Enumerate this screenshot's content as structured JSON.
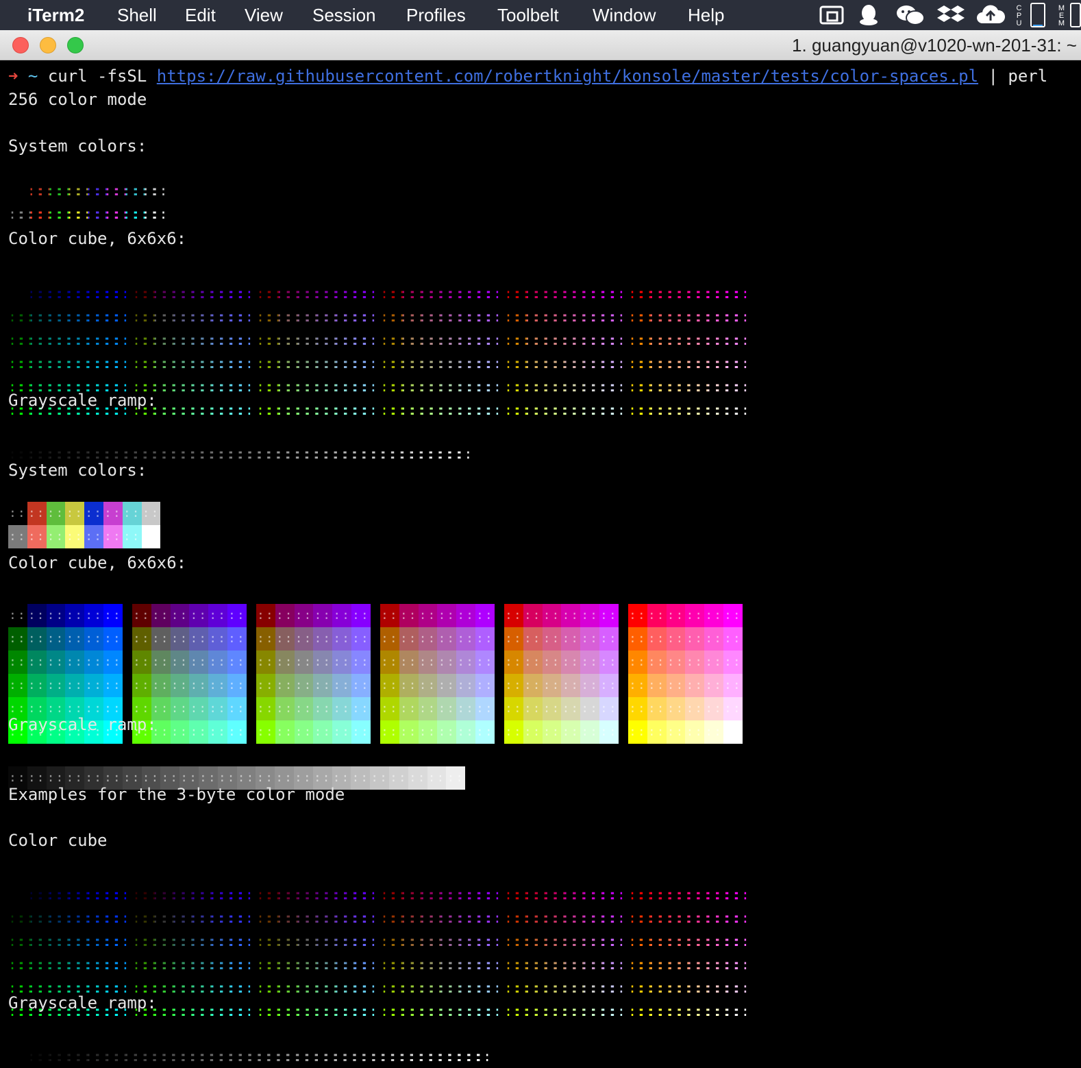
{
  "menubar": {
    "app": "iTerm2",
    "items": [
      "Shell",
      "Edit",
      "View",
      "Session",
      "Profiles",
      "Toolbelt",
      "Window",
      "Help"
    ],
    "tray_icons": [
      "screen-mirror-icon",
      "qq-penguin-icon",
      "wechat-icon",
      "dropbox-icon",
      "cloud-upload-icon",
      "cpu-meter-icon",
      "memory-meter-icon"
    ],
    "cpu_label": "CPU",
    "mem_label": "MEM"
  },
  "window": {
    "tab_title": "1. guangyuan@v1020-wn-201-31: ~"
  },
  "terminal": {
    "command": {
      "arrow": "➜",
      "cwd": "~",
      "cmd_start": "curl -fsSL ",
      "url": "https://raw.githubusercontent.com/robertknight/konsole/master/tests/color-spaces.pl",
      "cmd_end": " | perl"
    },
    "mode_256": "256 color mode",
    "section1": {
      "system_colors": "System colors:",
      "color_cube": "Color cube, 6x6x6:",
      "grayscale": "Grayscale ramp:"
    },
    "section2": {
      "system_colors": "System colors:",
      "color_cube": "Color cube, 6x6x6:",
      "grayscale": "Grayscale ramp:"
    },
    "examples_3byte": "Examples for the 3-byte color mode",
    "section3": {
      "color_cube": "Color cube",
      "grayscale": "Grayscale ramp:"
    },
    "glyph": "::",
    "system_palette": [
      "#000000",
      "#c23621",
      "#25bc24",
      "#adad27",
      "#492ee1",
      "#d338d3",
      "#33bbc8",
      "#cbcccd",
      "#818383",
      "#fc391f",
      "#31e722",
      "#eaec23",
      "#5833ff",
      "#f935f8",
      "#14f0f0",
      "#e9ebeb"
    ],
    "system_bg_palette": [
      "#000000",
      "#c23621",
      "#5fbd3c",
      "#c8c83f",
      "#0b2ecf",
      "#c73fd0",
      "#66d3d6",
      "#c8c8c8",
      "#7b7b7b",
      "#ef6b5e",
      "#94ee72",
      "#fbfb77",
      "#5c6ff5",
      "#ef79f2",
      "#8ef8f8",
      "#ffffff"
    ]
  },
  "colors": {
    "menubar_bg": "#2b2f3a",
    "close": "#fc605c",
    "minimize": "#fdbc40",
    "zoom": "#34c84a",
    "terminal_bg": "#000000",
    "text": "#e6e6e6",
    "prompt_arrow": "#e8473d",
    "prompt_tilde": "#5fc4f0",
    "url": "#3f6fe0"
  }
}
